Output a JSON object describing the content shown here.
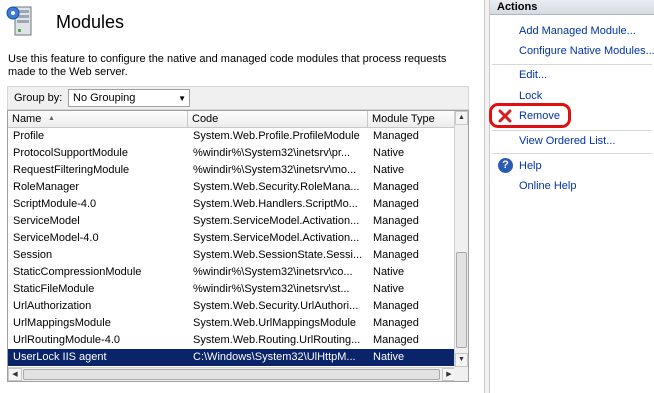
{
  "page": {
    "title": "Modules",
    "description_line1": "Use this feature to configure the native and managed code modules that process requests",
    "description_line2": "made to the Web server."
  },
  "group_by": {
    "label": "Group by:",
    "value": "No Grouping"
  },
  "table": {
    "columns": [
      "Name",
      "Code",
      "Module Type"
    ],
    "rows": [
      {
        "name": "Profile",
        "code": "System.Web.Profile.ProfileModule",
        "type": "Managed"
      },
      {
        "name": "ProtocolSupportModule",
        "code": "%windir%\\System32\\inetsrv\\pr...",
        "type": "Native"
      },
      {
        "name": "RequestFilteringModule",
        "code": "%windir%\\System32\\inetsrv\\mo...",
        "type": "Native"
      },
      {
        "name": "RoleManager",
        "code": "System.Web.Security.RoleMana...",
        "type": "Managed"
      },
      {
        "name": "ScriptModule-4.0",
        "code": "System.Web.Handlers.ScriptMo...",
        "type": "Managed"
      },
      {
        "name": "ServiceModel",
        "code": "System.ServiceModel.Activation...",
        "type": "Managed"
      },
      {
        "name": "ServiceModel-4.0",
        "code": "System.ServiceModel.Activation...",
        "type": "Managed"
      },
      {
        "name": "Session",
        "code": "System.Web.SessionState.Sessi...",
        "type": "Managed"
      },
      {
        "name": "StaticCompressionModule",
        "code": "%windir%\\System32\\inetsrv\\co...",
        "type": "Native"
      },
      {
        "name": "StaticFileModule",
        "code": "%windir%\\System32\\inetsrv\\st...",
        "type": "Native"
      },
      {
        "name": "UrlAuthorization",
        "code": "System.Web.Security.UrlAuthori...",
        "type": "Managed"
      },
      {
        "name": "UrlMappingsModule",
        "code": "System.Web.UrlMappingsModule",
        "type": "Managed"
      },
      {
        "name": "UrlRoutingModule-4.0",
        "code": "System.Web.Routing.UrlRouting...",
        "type": "Managed"
      },
      {
        "name": "UserLock IIS agent",
        "code": "C:\\Windows\\System32\\UlHttpM...",
        "type": "Native",
        "selected": true
      }
    ]
  },
  "actions": {
    "header": "Actions",
    "add_managed": "Add Managed Module...",
    "configure_native": "Configure Native Modules...",
    "edit": "Edit...",
    "lock": "Lock",
    "remove": "Remove",
    "view_ordered": "View Ordered List...",
    "help": "Help",
    "online_help": "Online Help"
  },
  "colors": {
    "selection": "#0a246a",
    "link": "#0033aa",
    "highlight_ring": "#e01010",
    "remove_icon": "#d42020"
  },
  "icons": {
    "title": "server-modules-icon",
    "remove": "red-x-icon",
    "help": "help-icon"
  }
}
